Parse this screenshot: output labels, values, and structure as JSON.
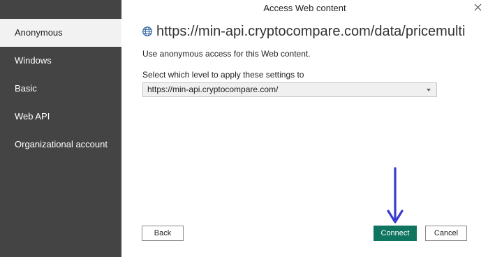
{
  "dialog": {
    "title": "Access Web content"
  },
  "sidebar": {
    "items": [
      {
        "label": "Anonymous",
        "selected": true
      },
      {
        "label": "Windows",
        "selected": false
      },
      {
        "label": "Basic",
        "selected": false
      },
      {
        "label": "Web API",
        "selected": false
      },
      {
        "label": "Organizational account",
        "selected": false
      }
    ]
  },
  "main": {
    "url": "https://min-api.cryptocompare.com/data/pricemulti",
    "url_icon": "globe-icon",
    "description": "Use anonymous access for this Web content.",
    "level_label": "Select which level to apply these settings to",
    "level_selected": "https://min-api.cryptocompare.com/"
  },
  "buttons": {
    "back": "Back",
    "connect": "Connect",
    "cancel": "Cancel"
  },
  "colors": {
    "sidebar_bg": "#444444",
    "selected_item_bg": "#f2f2f2",
    "connect_bg": "#0f7560",
    "annotation_arrow": "#3b3bcf"
  }
}
